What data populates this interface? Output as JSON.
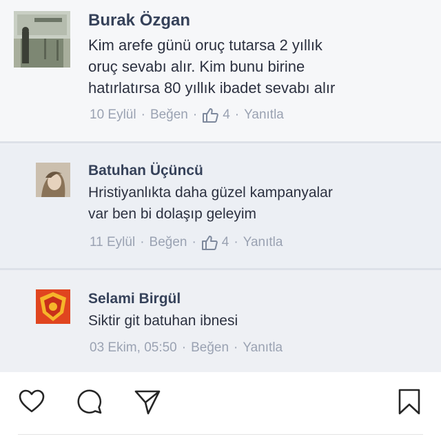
{
  "comments": [
    {
      "name": "Burak Özgan",
      "lines": [
        "Kim arefe günü oruç tutarsa 2 yıllık",
        "oruç sevabı alır. Kim bunu birine",
        "hatırlatırsa 80 yıllık ibadet sevabı alır"
      ],
      "date": "10 Eylül",
      "like_label": "Beğen",
      "like_count": "4",
      "reply_label": "Yanıtla"
    },
    {
      "name": "Batuhan Üçüncü",
      "lines": [
        "Hristiyanlıkta daha güzel kampanyalar",
        "var ben bi dolaşıp geleyim"
      ],
      "date": "11 Eylül",
      "like_label": "Beğen",
      "like_count": "4",
      "reply_label": "Yanıtla"
    },
    {
      "name": "Selami Birgül",
      "lines": [
        "Siktir git batuhan ibnesi"
      ],
      "date": "03 Ekim, 05:50",
      "like_label": "Beğen",
      "reply_label": "Yanıtla"
    }
  ],
  "meta_separator": "·",
  "icons": {
    "like": "thumbs-up-icon",
    "actions": [
      "heart-icon",
      "comment-icon",
      "share-icon",
      "bookmark-icon"
    ]
  },
  "colors": {
    "name": "#36425a",
    "meta": "#9aa2b2",
    "crest": "#e0451f"
  }
}
